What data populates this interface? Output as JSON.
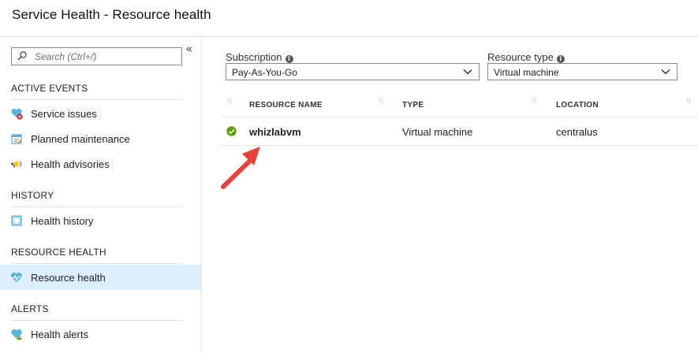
{
  "header": {
    "title": "Service Health - Resource health"
  },
  "sidebar": {
    "collapse_glyph": "«",
    "search": {
      "placeholder": "Search (Ctrl+/)",
      "icon": "search-icon"
    },
    "sections": [
      {
        "heading": "ACTIVE EVENTS",
        "items": [
          {
            "label": "Service issues",
            "icon": "service-issues-icon"
          },
          {
            "label": "Planned maintenance",
            "icon": "planned-maintenance-icon"
          },
          {
            "label": "Health advisories",
            "icon": "megaphone-icon"
          }
        ]
      },
      {
        "heading": "HISTORY",
        "items": [
          {
            "label": "Health history",
            "icon": "health-history-icon"
          }
        ]
      },
      {
        "heading": "RESOURCE HEALTH",
        "items": [
          {
            "label": "Resource health",
            "icon": "heart-pulse-icon",
            "active": true
          }
        ]
      },
      {
        "heading": "ALERTS",
        "items": [
          {
            "label": "Health alerts",
            "icon": "health-alerts-icon"
          }
        ]
      }
    ]
  },
  "filters": {
    "subscription": {
      "label": "Subscription",
      "value": "Pay-As-You-Go"
    },
    "resource_type": {
      "label": "Resource type",
      "value": "Virtual machine"
    }
  },
  "table": {
    "columns": [
      "RESOURCE NAME",
      "TYPE",
      "LOCATION"
    ],
    "rows": [
      {
        "status": "available",
        "name": "whizlabvm",
        "type": "Virtual machine",
        "location": "centralus"
      }
    ]
  },
  "colors": {
    "accent": "#0078d4",
    "active_bg": "#ddeefc",
    "status_ok": "#57a300",
    "annotation_arrow": "#e8413a"
  }
}
